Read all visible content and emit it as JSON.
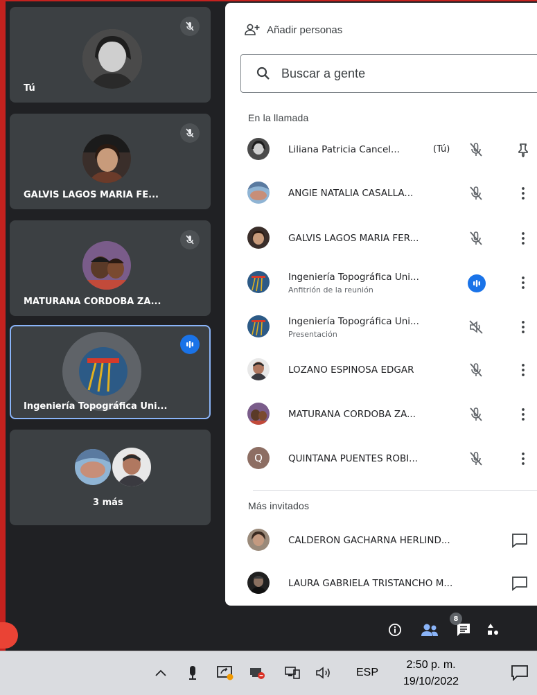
{
  "tiles": [
    {
      "name": "Tú",
      "muted": true
    },
    {
      "name": "GALVIS LAGOS MARIA FE...",
      "muted": true
    },
    {
      "name": "MATURANA CORDOBA ZA...",
      "muted": true
    },
    {
      "name": "Ingeniería Topográfica Uni...",
      "speaking": true
    },
    {
      "name": "3 más"
    }
  ],
  "panel": {
    "add_people": "Añadir personas",
    "search_placeholder": "Buscar a gente",
    "in_call_title": "En la llamada",
    "more_invited_title": "Más invitados",
    "participants": [
      {
        "name": "Liliana Patricia Cancel...",
        "you": "(Tú)",
        "icon": "mic-off-icon",
        "action": "pin-icon"
      },
      {
        "name": "ANGIE NATALIA CASALLA...",
        "icon": "mic-off-icon",
        "action": "more-icon"
      },
      {
        "name": "GALVIS LAGOS MARIA FER...",
        "icon": "mic-off-icon",
        "action": "more-icon"
      },
      {
        "name": "Ingeniería Topográfica Uni...",
        "sub": "Anfitrión de la reunión",
        "icon": "speaking-icon",
        "action": "more-icon"
      },
      {
        "name": "Ingeniería Topográfica Uni...",
        "sub": "Presentación",
        "icon": "speaker-off-icon",
        "action": "more-icon"
      },
      {
        "name": "LOZANO ESPINOSA EDGAR",
        "icon": "mic-off-icon",
        "action": "more-icon"
      },
      {
        "name": "MATURANA CORDOBA ZA...",
        "icon": "mic-off-icon",
        "action": "more-icon"
      },
      {
        "name": "QUINTANA PUENTES ROBI...",
        "initial": "Q",
        "icon": "mic-off-icon",
        "action": "more-icon"
      }
    ],
    "invited": [
      {
        "name": "CALDERON GACHARNA HERLIND...",
        "action": "chat-icon"
      },
      {
        "name": "LAURA GABRIELA TRISTANCHO M...",
        "action": "chat-icon"
      }
    ]
  },
  "controls": {
    "people_count": "8"
  },
  "taskbar": {
    "language": "ESP",
    "time": "2:50 p. m.",
    "date": "19/10/2022"
  },
  "colors": {
    "accent": "#1a73e8",
    "tile_bg": "#3c4043",
    "stage_bg": "#202124",
    "frame": "#c5221f",
    "initial_avatar": "#8d6e63"
  }
}
